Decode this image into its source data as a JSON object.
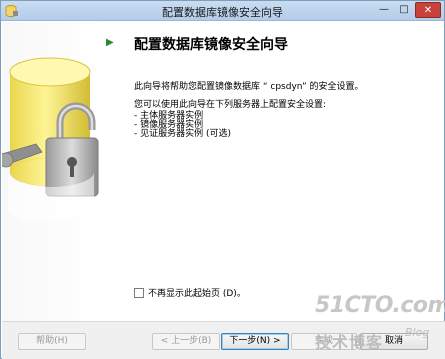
{
  "window": {
    "title": "配置数据库镜像安全向导",
    "controls": {
      "minimize": "—",
      "maximize": "□",
      "close": "✕"
    }
  },
  "main": {
    "heading": "配置数据库镜像安全向导",
    "intro": "此向导将帮助您配置镜像数据库 “ cpsdyn” 的安全设置。",
    "sub": "您可以使用此向导在下列服务器上配置安全设置:",
    "servers": [
      "- 主体服务器实例",
      "- 镜像服务器实例",
      "- 见证服务器实例 (可选)"
    ],
    "checkbox_label": "不再显示此起始页 (D)。",
    "checkbox_checked": false
  },
  "footer": {
    "help": "帮助(H)",
    "prev": "< 上一步(B)",
    "next": "下一步(N) >",
    "finish": "完成",
    "cancel": "取消"
  },
  "watermark": {
    "top": "51CTO.com",
    "bottom": "技术博客",
    "blog": "Blog"
  },
  "colors": {
    "accent_arrow": "#2a8a2a",
    "title_bar": "#c9ddf2",
    "close_button": "#c7433a"
  }
}
